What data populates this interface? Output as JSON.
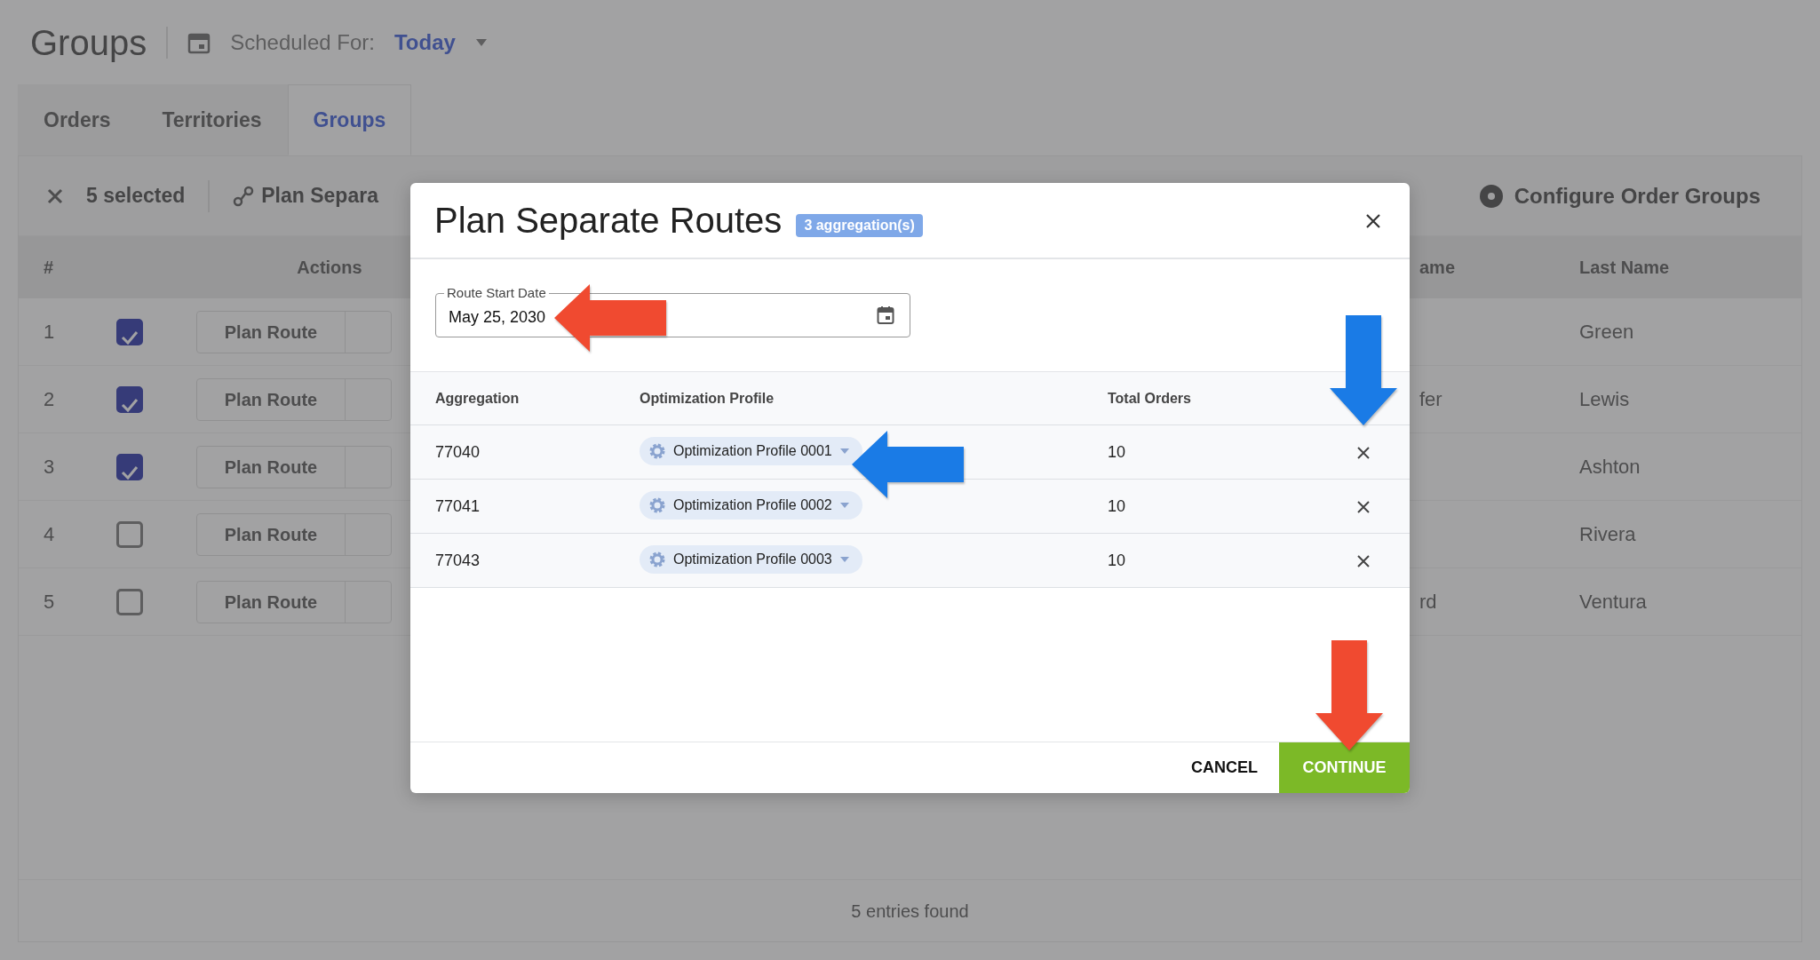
{
  "page": {
    "title": "Groups",
    "schedule_label": "Scheduled For:",
    "schedule_value": "Today"
  },
  "tabs": [
    {
      "label": "Orders",
      "selected": false
    },
    {
      "label": "Territories",
      "selected": false
    },
    {
      "label": "Groups",
      "selected": true
    }
  ],
  "toolbar": {
    "selection": "5 selected",
    "plan_button": "Plan Separa",
    "configure_button": "Configure Order Groups"
  },
  "table": {
    "columns": [
      "#",
      "Actions",
      "ame",
      "Last Name"
    ],
    "rows": [
      {
        "number": "1",
        "checked": true,
        "action": "Plan Route",
        "last_name": "Green"
      },
      {
        "number": "2",
        "checked": true,
        "action": "Plan Route",
        "column_3": "fer",
        "last_name": "Lewis"
      },
      {
        "number": "3",
        "checked": true,
        "action": "Plan Route",
        "last_name": "Ashton"
      },
      {
        "number": "4",
        "checked": false,
        "action": "Plan Route",
        "last_name": "Rivera"
      },
      {
        "number": "5",
        "checked": false,
        "action": "Plan Route",
        "column_3": "rd",
        "last_name": "Ventura"
      }
    ]
  },
  "footer": "5 entries found",
  "dialog": {
    "title": "Plan Separate Routes",
    "badge": "3 aggregation(s)",
    "date_field": {
      "label": "Route Start Date",
      "value": "May 25, 2030",
      "annotation": {
        "kind": "left",
        "color": "#f04a30"
      }
    },
    "columns": [
      "Aggregation",
      "Optimization Profile",
      "Total Orders"
    ],
    "rows": [
      {
        "aggregation": "77040",
        "profile": "Optimization Profile 0001",
        "total_orders": "10",
        "profile_annotation": {
          "kind": "left",
          "color": "#1a7be6"
        },
        "remove_annotation": {
          "kind": "down",
          "color": "#1a7be6"
        }
      },
      {
        "aggregation": "77041",
        "profile": "Optimization Profile 0002",
        "total_orders": "10"
      },
      {
        "aggregation": "77043",
        "profile": "Optimization Profile 0003",
        "total_orders": "10"
      }
    ],
    "buttons": [
      {
        "label": "CANCEL",
        "kind": "text"
      },
      {
        "label": "CONTINUE",
        "kind": "primary",
        "annotation": {
          "kind": "down",
          "color": "#f04a30"
        }
      }
    ]
  }
}
